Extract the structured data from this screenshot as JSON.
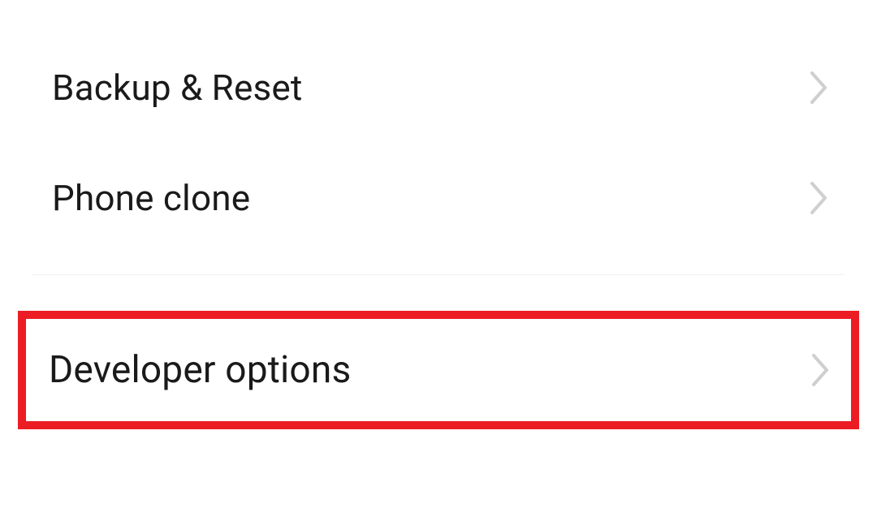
{
  "settings": {
    "items": [
      {
        "label": "Backup & Reset"
      },
      {
        "label": "Phone clone"
      },
      {
        "label": "Developer options"
      }
    ]
  }
}
